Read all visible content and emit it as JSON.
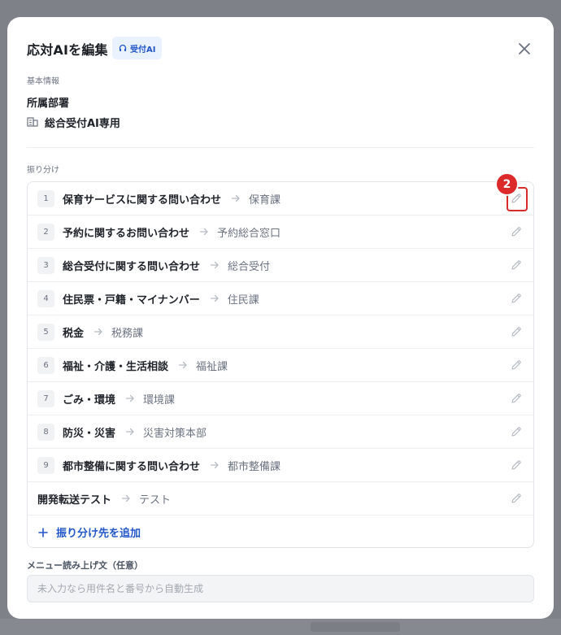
{
  "header": {
    "title": "応対AIを編集",
    "badge": "受付AI",
    "badge_icon": "headset-icon",
    "close_icon": "close-icon"
  },
  "basic_info": {
    "section_label": "基本情報",
    "department_title": "所属部署",
    "department_icon": "building-icon",
    "department_name": "総合受付AI専用"
  },
  "routing": {
    "section_label": "振り分け",
    "marker": "2",
    "rows": [
      {
        "num": "1",
        "label": "保育サービスに関する問い合わせ",
        "dest": "保育課"
      },
      {
        "num": "2",
        "label": "予約に関するお問い合わせ",
        "dest": "予約総合窓口"
      },
      {
        "num": "3",
        "label": "総合受付に関する問い合わせ",
        "dest": "総合受付"
      },
      {
        "num": "4",
        "label": "住民票・戸籍・マイナンバー",
        "dest": "住民課"
      },
      {
        "num": "5",
        "label": "税金",
        "dest": "税務課"
      },
      {
        "num": "6",
        "label": "福祉・介護・生活相談",
        "dest": "福祉課"
      },
      {
        "num": "7",
        "label": "ごみ・環境",
        "dest": "環境課"
      },
      {
        "num": "8",
        "label": "防災・災害",
        "dest": "災害対策本部"
      },
      {
        "num": "9",
        "label": "都市整備に関する問い合わせ",
        "dest": "都市整備課"
      },
      {
        "num": "",
        "label": "開発転送テスト",
        "dest": "テスト"
      }
    ],
    "add_label": "振り分け先を追加"
  },
  "menu": {
    "label": "メニュー読み上げ文（任意）",
    "value": "",
    "placeholder": "未入力なら用件名と番号から自動生成"
  },
  "colors": {
    "accent": "#2357c7",
    "marker": "#dc2a2a",
    "badge_bg": "#eaf1ff"
  }
}
